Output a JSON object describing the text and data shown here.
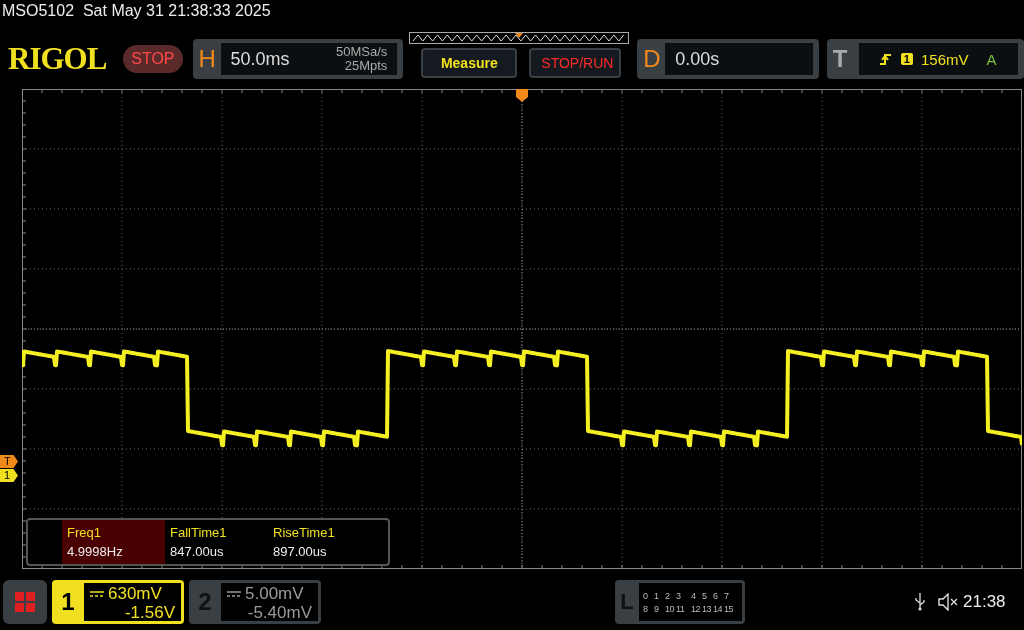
{
  "status_line": {
    "model": "MSO5102",
    "datetime": "Sat May 31 21:38:33 2025"
  },
  "header": {
    "logo": "RIGOL",
    "run_state": "STOP",
    "horizontal": {
      "label": "H",
      "timebase": "50.0ms",
      "sample_rate": "50MSa/s",
      "memory_depth": "25Mpts"
    },
    "buttons": [
      "Measure",
      "STOP/RUN"
    ],
    "delay": {
      "label": "D",
      "value": "0.00s"
    },
    "trigger": {
      "label": "T",
      "source": "1",
      "level": "156mV",
      "mode": "A"
    }
  },
  "markers": [
    "T",
    "1"
  ],
  "measurements": [
    {
      "name": "Freq1",
      "value": "4.9998Hz",
      "selected": true
    },
    {
      "name": "FallTime1",
      "value": "847.00us",
      "selected": false
    },
    {
      "name": "RiseTime1",
      "value": "897.00us",
      "selected": false
    }
  ],
  "channels": [
    {
      "number": "1",
      "scale": "630mV",
      "offset": "-1.56V",
      "selected": true
    },
    {
      "number": "2",
      "scale": "5.00mV",
      "offset": "-5.40mV",
      "selected": false
    }
  ],
  "logic": {
    "label": "L",
    "rows": [
      [
        "0",
        "1",
        "2",
        "3",
        "4",
        "5",
        "6",
        "7"
      ],
      [
        "8",
        "9",
        "10",
        "11",
        "12",
        "13",
        "14",
        "15"
      ]
    ]
  },
  "clock": "21:38"
}
